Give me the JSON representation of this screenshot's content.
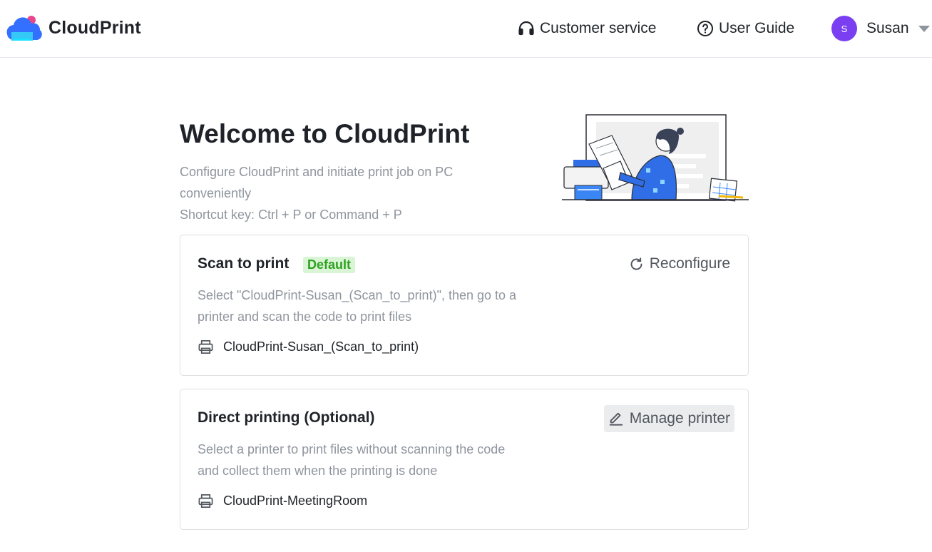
{
  "app": {
    "name": "CloudPrint"
  },
  "nav": {
    "customer_service": "Customer service",
    "user_guide": "User Guide",
    "user": {
      "avatar_initial": "S",
      "name": "Susan"
    }
  },
  "hero": {
    "title": "Welcome to CloudPrint",
    "description_line1": "Configure CloudPrint and initiate print job on PC",
    "description_line2": "conveniently",
    "shortcut": "Shortcut key: Ctrl + P or Command + P"
  },
  "scan_card": {
    "title": "Scan to print",
    "badge": "Default",
    "action": "Reconfigure",
    "description": "Select \"CloudPrint-Susan_(Scan_to_print)\", then go to a printer and scan the code to print files",
    "printer": "CloudPrint-Susan_(Scan_to_print)"
  },
  "direct_card": {
    "title": "Direct printing (Optional)",
    "action": "Manage printer",
    "description": "Select a printer to print files without scanning the code and collect them when the printing is done",
    "printer": "CloudPrint-MeetingRoom"
  },
  "icons": {
    "logo": "cloud-printer-logo",
    "customer_service": "headset-icon",
    "user_guide": "question-circle-icon",
    "reconfigure": "refresh-icon",
    "manage_printer": "pencil-icon",
    "printer": "printer-icon"
  },
  "colors": {
    "accent_purple": "#7b3ff2",
    "badge_green": "#2ea121",
    "badge_bg": "#d9f5d6",
    "muted_text": "#8f959e",
    "logo_blue": "#3370ff"
  }
}
